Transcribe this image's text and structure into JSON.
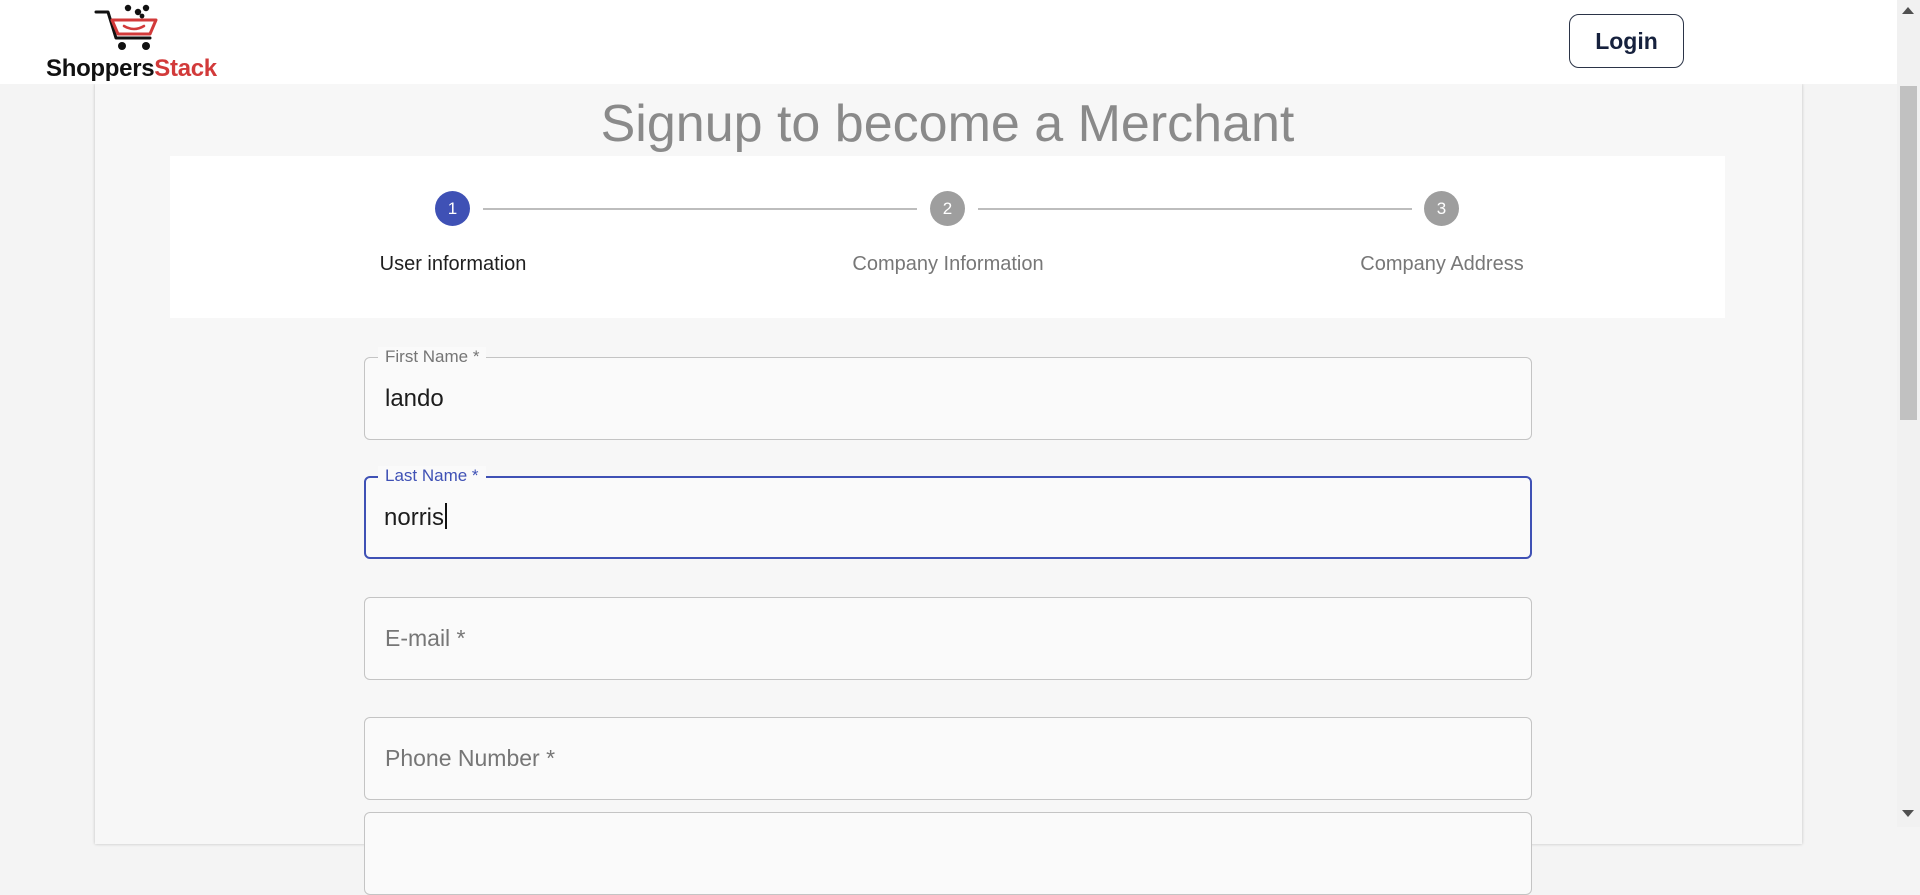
{
  "header": {
    "brand_part1": "Shoppers",
    "brand_part2": "Stack",
    "login_label": "Login"
  },
  "page": {
    "title": "Signup to become a Merchant"
  },
  "stepper": {
    "steps": [
      {
        "number": "1",
        "label": "User information",
        "active": true
      },
      {
        "number": "2",
        "label": "Company Information",
        "active": false
      },
      {
        "number": "3",
        "label": "Company Address",
        "active": false
      }
    ]
  },
  "form": {
    "first_name": {
      "label": "First Name *",
      "value": "lando"
    },
    "last_name": {
      "label": "Last Name *",
      "value": "norris"
    },
    "email": {
      "placeholder": "E-mail *"
    },
    "phone": {
      "placeholder": "Phone Number *"
    }
  },
  "colors": {
    "accent": "#3f51b5",
    "brand_red": "#d23a3a",
    "inactive_step": "#9e9e9e"
  }
}
